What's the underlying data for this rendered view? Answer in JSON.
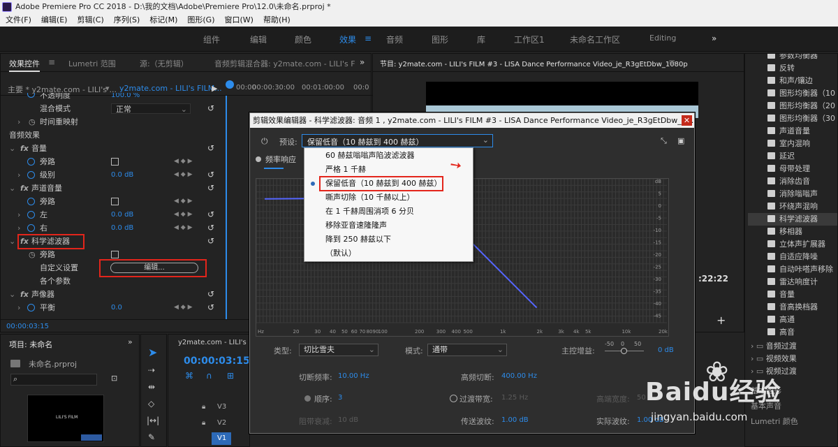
{
  "window_title": "Adobe Premiere Pro CC 2018 - D:\\我的文档\\Adobe\\Premiere Pro\\12.0\\未命名.prproj *",
  "menu": [
    "文件(F)",
    "编辑(E)",
    "剪辑(C)",
    "序列(S)",
    "标记(M)",
    "图形(G)",
    "窗口(W)",
    "帮助(H)"
  ],
  "workspaces": [
    "组件",
    "编辑",
    "颜色",
    "效果",
    "音频",
    "图形",
    "库",
    "工作区1",
    "未命名工作区",
    "Editing"
  ],
  "effect_controls": {
    "tabs": [
      "效果控件",
      "Lumetri 范围",
      "源:（无剪辑）",
      "音频剪辑混合器: y2mate.com - LILI's F"
    ],
    "master": "主要 * y2mate.com - LILI's ...",
    "clip": "y2mate.com - LILI's FILM...",
    "ruler": [
      "00:00",
      "00:00:30:00",
      "00:01:00:00",
      "00:0"
    ],
    "opacity_label": "不透明度",
    "opacity_value": "100.0 %",
    "blend_label": "混合模式",
    "blend_value": "正常",
    "time_remap": "时间重映射",
    "audio_effects": "音频效果",
    "volume": "音量",
    "bypass": "旁路",
    "level": "级别",
    "level_value": "0.0 dB",
    "channel_volume": "声道音量",
    "left": "左",
    "left_value": "0.0 dB",
    "right": "右",
    "right_value": "0.0 dB",
    "science_filter": "科学滤波器",
    "custom_setup": "自定义设置",
    "edit_button": "编辑...",
    "params": "各个参数",
    "panner": "声像器",
    "balance": "平衡",
    "balance_value": "0.0",
    "timecode": "00:00:03:15"
  },
  "program": {
    "title": "节目: y2mate.com - LILI's FILM #3 - LISA Dance Performance Video_je_R3gEtDbw_1080p",
    "time": ":22:22"
  },
  "project": {
    "title": "项目: 未命名",
    "file": "未命名.prproj",
    "thumb_text": "LILI'S FILM"
  },
  "timeline": {
    "tab": "y2mate.com - LILI's",
    "timecode": "00:00:03:15",
    "tracks": [
      "V3",
      "V2",
      "V1"
    ]
  },
  "effects_list": {
    "items": [
      "参数均衡器",
      "反转",
      "和声/镶边",
      "图形均衡器（10",
      "图形均衡器（20",
      "图形均衡器（30",
      "声道音量",
      "室内混响",
      "延迟",
      "母带处理",
      "消除齿音",
      "消除嗡嗡声",
      "环绕声混响",
      "科学滤波器",
      "移相器",
      "立体声扩展器",
      "自适应降噪",
      "自动咔嗒声移除",
      "雷达响度计",
      "音量",
      "音高换档器",
      "高通",
      "高音"
    ],
    "folders": [
      "音频过渡",
      "视频效果",
      "视频过渡"
    ],
    "bottom": [
      "基本图形",
      "基本声音",
      "Lumetri 颜色"
    ]
  },
  "dialog": {
    "title": "剪辑效果编辑器 - 科学滤波器: 音频 1 , y2mate.com - LILI's FILM #3 - LISA Dance Performance Video_je_R3gEtDbw_10...",
    "preset_label": "预设:",
    "preset_value": "保留低音（10 赫兹到 400 赫兹）",
    "freq_resp": "频率响应",
    "presets": [
      "60 赫兹嗡嗡声陷波滤波器",
      "严格 1 千赫",
      "保留低音（10 赫兹到 400 赫兹）",
      "嘶声切除（10 千赫以上）",
      "在 1 千赫周围消项 6 分贝",
      "移除亚音速隆隆声",
      "降到 250 赫兹以下",
      "（默认）"
    ],
    "db_scale": [
      "dB",
      "5",
      "0",
      "-5",
      "-10",
      "-15",
      "-20",
      "-25",
      "-30",
      "-35",
      "-40",
      "-45"
    ],
    "freq_scale": [
      "Hz",
      "20",
      "30",
      "40",
      "50",
      "60",
      "70",
      "80",
      "90",
      "100",
      "200",
      "300",
      "400",
      "500",
      "1k",
      "2k",
      "3k",
      "4k",
      "5k",
      "10k",
      "20k"
    ],
    "type_label": "类型:",
    "type_value": "切比雪夫",
    "mode_label": "模式:",
    "mode_value": "通带",
    "master_gain_label": "主控增益:",
    "master_gain_value": "0 dB",
    "gain_scale": [
      "-50",
      "0",
      "50"
    ],
    "cutoff_label": "切断频率:",
    "cutoff_value": "10.00 Hz",
    "high_cutoff_label": "高频切断:",
    "high_cutoff_value": "400.00 Hz",
    "order_label": "顺序:",
    "order_value": "3",
    "transition_label": "过渡带宽:",
    "transition_value": "1.25 Hz",
    "high_width_label": "高端宽度:",
    "high_width_value": "50",
    "stop_atten_label": "阻带衰减:",
    "stop_atten_value": "10 dB",
    "pass_ripple_label": "传送波纹:",
    "pass_ripple_value": "1.00 dB",
    "actual_ripple_label": "实际波纹:",
    "actual_ripple_value": "1.00 dB"
  },
  "watermark": {
    "brand": "Baidu经验",
    "url": "jingyan.baidu.com"
  },
  "colors": {
    "accent": "#2d8ceb",
    "highlight": "#e3251b",
    "curve": "#5566ff"
  }
}
